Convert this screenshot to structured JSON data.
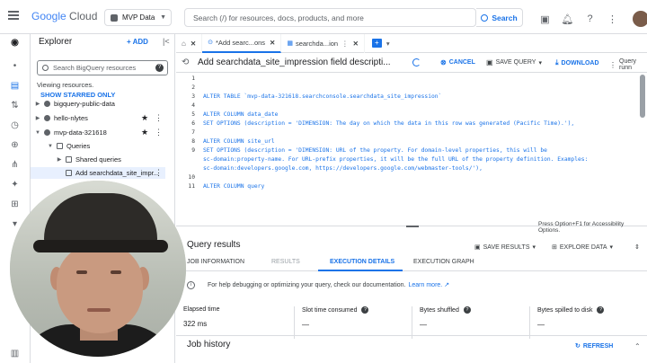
{
  "header": {
    "logo_google": "Google",
    "logo_cloud": "Cloud",
    "project_label": "MVP Data",
    "search_placeholder": "Search (/) for resources, docs, products, and more",
    "search_button": "Search"
  },
  "explorer": {
    "title": "Explorer",
    "add_label": "+ ADD",
    "search_placeholder": "Search BigQuery resources",
    "viewing_text": "Viewing resources.",
    "show_starred": "SHOW STARRED ONLY",
    "tree": [
      {
        "label": "bigquery-public-data",
        "level": 0
      },
      {
        "label": "hello-nlytes",
        "level": 0
      },
      {
        "label": "mvp-data-321618",
        "level": 0
      },
      {
        "label": "Queries",
        "level": 1
      },
      {
        "label": "Shared queries",
        "level": 2
      },
      {
        "label": "Add searchdata_site_impr...",
        "level": 2
      }
    ]
  },
  "tabs": [
    {
      "label": "*Add searc...ons",
      "active": true
    },
    {
      "label": "searchda...ion",
      "active": false
    }
  ],
  "toolbar": {
    "query_title": "Add searchdata_site_impression field descripti...",
    "cancel": "CANCEL",
    "save_query": "SAVE QUERY",
    "download": "DOWNLOAD",
    "query_run": "Query runn"
  },
  "editor": {
    "lines": [
      {
        "n": "1",
        "text": ""
      },
      {
        "n": "2",
        "text": ""
      },
      {
        "n": "3",
        "text": "ALTER TABLE `mvp-data-321618.searchconsole.searchdata_site_impression`"
      },
      {
        "n": "4",
        "text": ""
      },
      {
        "n": "5",
        "text": "ALTER COLUMN data_date"
      },
      {
        "n": "6",
        "text": "SET OPTIONS (description = 'DIMENSION: The day on which the data in this row was generated (Pacific Time).'),"
      },
      {
        "n": "7",
        "text": ""
      },
      {
        "n": "8",
        "text": "ALTER COLUMN site_url"
      },
      {
        "n": "9",
        "text": "SET OPTIONS (description = 'DIMENSION: URL of the property. For domain-level properties, this will be"
      },
      {
        "n": "",
        "text": "sc-domain:property-name. For URL-prefix properties, it will be the full URL of the property definition. Examples:"
      },
      {
        "n": "",
        "text": "sc-domain:developers.google.com, https://developers.google.com/webmaster-tools/'),"
      },
      {
        "n": "10",
        "text": ""
      },
      {
        "n": "11",
        "text": "ALTER COLUMN query"
      }
    ],
    "a11y_hint": "Press Option+F1 for Accessibility Options."
  },
  "results": {
    "title": "Query results",
    "save_results": "SAVE RESULTS",
    "explore_data": "EXPLORE DATA",
    "tabs": [
      "JOB INFORMATION",
      "RESULTS",
      "EXECUTION DETAILS",
      "EXECUTION GRAPH"
    ],
    "info_text": "For help debugging or optimizing your query, check our documentation.",
    "info_link": "Learn more.",
    "stats": [
      {
        "label": "Elapsed time",
        "value": "322 ms",
        "help": false
      },
      {
        "label": "Slot time consumed",
        "value": "—",
        "help": true
      },
      {
        "label": "Bytes shuffled",
        "value": "—",
        "help": true
      },
      {
        "label": "Bytes spilled to disk",
        "value": "—",
        "help": true
      }
    ],
    "job_history": "Job history",
    "refresh": "REFRESH"
  }
}
